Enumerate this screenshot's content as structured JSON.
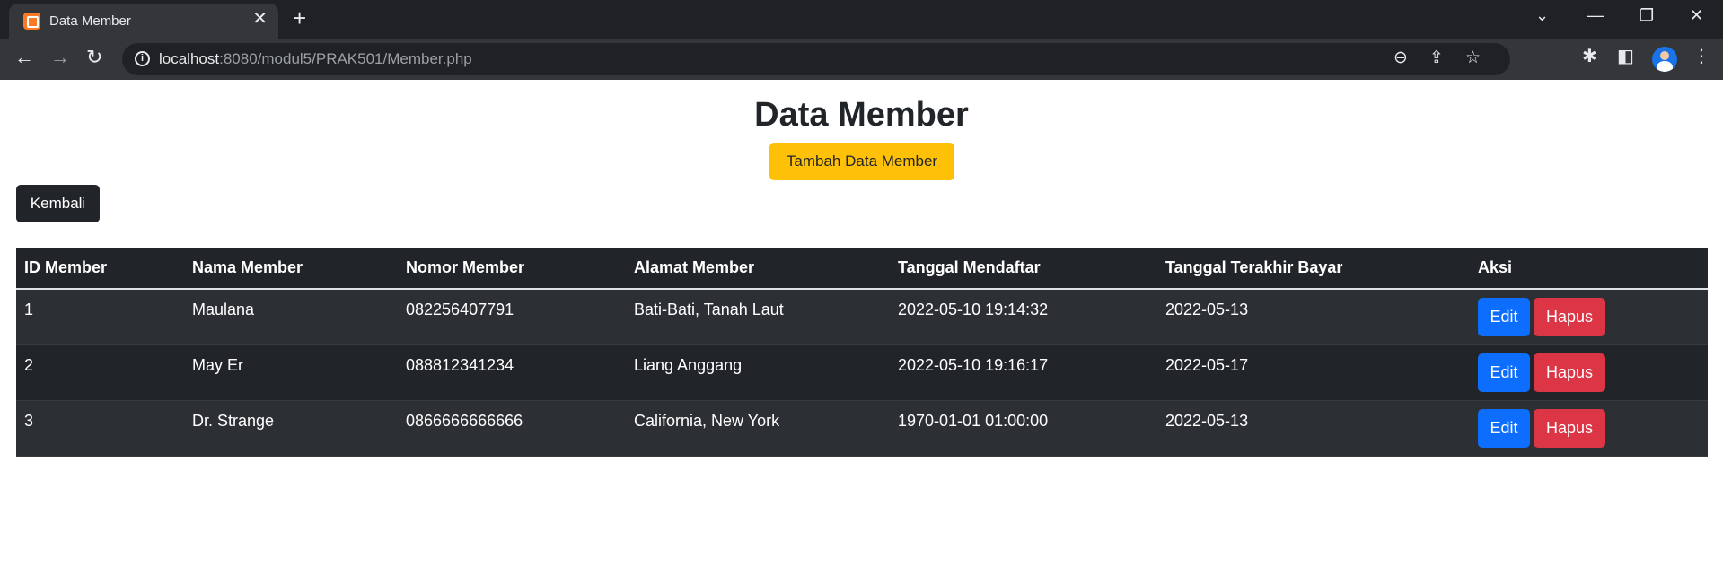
{
  "browser": {
    "tab_title": "Data Member",
    "url_host": "localhost",
    "url_path": ":8080/modul5/PRAK501/Member.php"
  },
  "page": {
    "title": "Data Member",
    "add_button": "Tambah Data Member",
    "back_button": "Kembali"
  },
  "table": {
    "headers": [
      "ID Member",
      "Nama Member",
      "Nomor Member",
      "Alamat Member",
      "Tanggal Mendaftar",
      "Tanggal Terakhir Bayar",
      "Aksi"
    ],
    "rows": [
      {
        "id": "1",
        "nama": "Maulana",
        "nomor": "082256407791",
        "alamat": "Bati-Bati, Tanah Laut",
        "tgl_daftar": "2022-05-10 19:14:32",
        "tgl_bayar": "2022-05-13"
      },
      {
        "id": "2",
        "nama": "May Er",
        "nomor": "088812341234",
        "alamat": "Liang Anggang",
        "tgl_daftar": "2022-05-10 19:16:17",
        "tgl_bayar": "2022-05-17"
      },
      {
        "id": "3",
        "nama": "Dr. Strange",
        "nomor": "0866666666666",
        "alamat": "California, New York",
        "tgl_daftar": "1970-01-01 01:00:00",
        "tgl_bayar": "2022-05-13"
      }
    ],
    "edit_label": "Edit",
    "delete_label": "Hapus"
  },
  "colors": {
    "warning": "#ffc107",
    "dark": "#212529",
    "primary": "#0d6efd",
    "danger": "#dc3545"
  }
}
